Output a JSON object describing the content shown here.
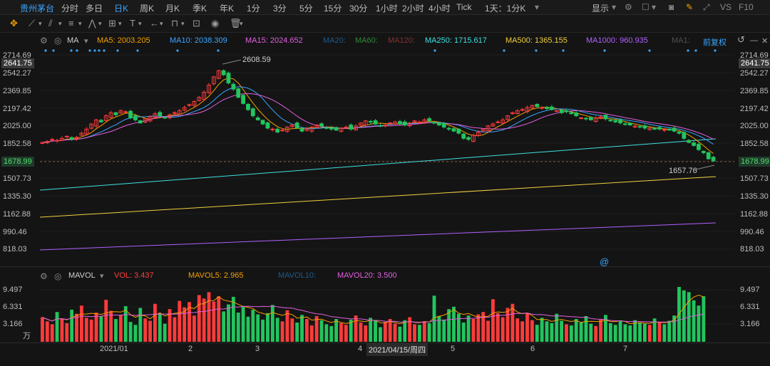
{
  "topbar": {
    "stock_name": "贵州茅台",
    "periods": [
      "分时",
      "多日",
      "日K",
      "周K",
      "月K",
      "季K",
      "年K",
      "1分",
      "3分",
      "5分",
      "15分",
      "30分",
      "1小时",
      "2小时",
      "4小时",
      "Tick"
    ],
    "active_period": "日K",
    "range_select": "1天：1分K",
    "display_label": "显示",
    "vs_label": "VS",
    "f10_label": "F10"
  },
  "ma_bar": {
    "ma_title": "MA",
    "items": [
      {
        "label": "MA5: 2003.205",
        "color": "#f3a000"
      },
      {
        "label": "MA10: 2038.309",
        "color": "#3aa6ff"
      },
      {
        "label": "MA15: 2024.652",
        "color": "#e060e0"
      },
      {
        "label": "MA20:",
        "color": "#1e5a8a"
      },
      {
        "label": "MA60:",
        "color": "#2e8a3a"
      },
      {
        "label": "MA120:",
        "color": "#8a3030"
      },
      {
        "label": "MA250: 1715.617",
        "color": "#40e0e0"
      },
      {
        "label": "MA500: 1365.155",
        "color": "#f0d040"
      },
      {
        "label": "MA1000: 960.935",
        "color": "#b060ff"
      },
      {
        "label": "MA1:",
        "color": "#505050"
      }
    ],
    "adjust_label": "前复权"
  },
  "price_axis": {
    "ticks": [
      "2714.69",
      "2542.27",
      "2369.85",
      "2197.42",
      "2025.00",
      "1852.58",
      "1680.15",
      "1507.73",
      "1335.30",
      "1162.88",
      "990.46",
      "818.03"
    ],
    "left_highlight": "2641.75",
    "right_highlight": "2641.75",
    "current_price": "1678.99"
  },
  "annotations": {
    "high_label": "2608.59",
    "low_label": "1657.76"
  },
  "volume_bar": {
    "title": "MAVOL",
    "items": [
      {
        "label": "VOL: 3.437",
        "color": "#ff4040"
      },
      {
        "label": "MAVOL5: 2.965",
        "color": "#f3a000"
      },
      {
        "label": "MAVOL10:",
        "color": "#1e5a8a"
      },
      {
        "label": "MAVOL20: 3.500",
        "color": "#e060e0"
      }
    ],
    "ticks": [
      "9.497",
      "6.331",
      "3.166"
    ],
    "unit": "万"
  },
  "x_axis": {
    "labels": [
      "2021/01",
      "2",
      "3",
      "4",
      "5",
      "6",
      "7"
    ],
    "cursor_date": "2021/04/15/周四"
  },
  "chart_data": {
    "type": "candlestick",
    "ylim": [
      818.03,
      2714.69
    ],
    "dates_start": "2021-01",
    "closes": [
      1860,
      1870,
      1890,
      1880,
      1900,
      1920,
      1890,
      1910,
      1950,
      1990,
      2040,
      2080,
      2060,
      2120,
      2150,
      2130,
      2170,
      2160,
      2100,
      2080,
      2050,
      2090,
      2110,
      2140,
      2120,
      2100,
      2130,
      2150,
      2170,
      2200,
      2230,
      2260,
      2300,
      2350,
      2420,
      2500,
      2560,
      2520,
      2440,
      2380,
      2300,
      2240,
      2180,
      2120,
      2080,
      2040,
      2000,
      1990,
      1960,
      1980,
      2010,
      2030,
      2000,
      1970,
      1990,
      2010,
      2030,
      2020,
      2000,
      1990,
      1980,
      2000,
      2010,
      1990,
      2020,
      2050,
      2070,
      2060,
      2040,
      2020,
      2030,
      2050,
      2060,
      2040,
      2030,
      2050,
      2070,
      2060,
      2080,
      2070,
      2050,
      2030,
      2010,
      1990,
      1970,
      1950,
      1900,
      1890,
      1930,
      1960,
      1990,
      2020,
      2040,
      2060,
      2080,
      2120,
      2150,
      2170,
      2180,
      2200,
      2220,
      2210,
      2200,
      2190,
      2180,
      2170,
      2150,
      2160,
      2140,
      2120,
      2100,
      2090,
      2080,
      2100,
      2110,
      2090,
      2070,
      2060,
      2050,
      2040,
      2030,
      2020,
      2010,
      2000,
      2000,
      1990,
      1990,
      1985,
      1980,
      1970,
      1950,
      1900,
      1860,
      1830,
      1790,
      1760,
      1700,
      1680
    ],
    "volumes": [
      4.2,
      3.5,
      3.0,
      5.1,
      4.0,
      3.2,
      5.5,
      4.8,
      6.2,
      4.1,
      3.8,
      5.0,
      4.4,
      7.2,
      5.3,
      3.9,
      4.6,
      6.1,
      3.4,
      2.9,
      5.8,
      4.0,
      3.6,
      6.5,
      4.9,
      3.1,
      5.6,
      4.2,
      7.0,
      5.9,
      6.8,
      4.5,
      8.0,
      7.4,
      8.5,
      6.9,
      7.8,
      5.2,
      6.4,
      7.7,
      5.0,
      6.0,
      4.3,
      5.5,
      4.7,
      3.8,
      4.9,
      6.3,
      4.1,
      3.5,
      5.4,
      4.0,
      3.3,
      4.6,
      3.9,
      2.8,
      4.4,
      3.7,
      3.0,
      2.7,
      3.9,
      3.2,
      2.9,
      3.8,
      4.5,
      3.3,
      2.8,
      4.1,
      3.6,
      2.5,
      3.4,
      3.9,
      3.1,
      2.6,
      3.7,
      4.2,
      3.0,
      2.9,
      3.5,
      3.2,
      7.9,
      4.4,
      3.8,
      5.6,
      6.0,
      4.8,
      3.3,
      4.5,
      3.9,
      4.7,
      5.1,
      3.6,
      7.3,
      4.9,
      4.2,
      5.8,
      6.5,
      4.0,
      3.5,
      4.9,
      3.7,
      2.9,
      4.1,
      3.5,
      3.2,
      4.8,
      3.6,
      3.0,
      2.8,
      3.9,
      3.3,
      4.4,
      3.1,
      2.7,
      3.8,
      4.6,
      3.2,
      2.9,
      3.6,
      3.0,
      2.8,
      3.7,
      3.3,
      3.1,
      2.9,
      4.0,
      3.4,
      3.0,
      3.6,
      4.5,
      9.4,
      8.8,
      8.5,
      7.1,
      6.2,
      7.8
    ]
  }
}
